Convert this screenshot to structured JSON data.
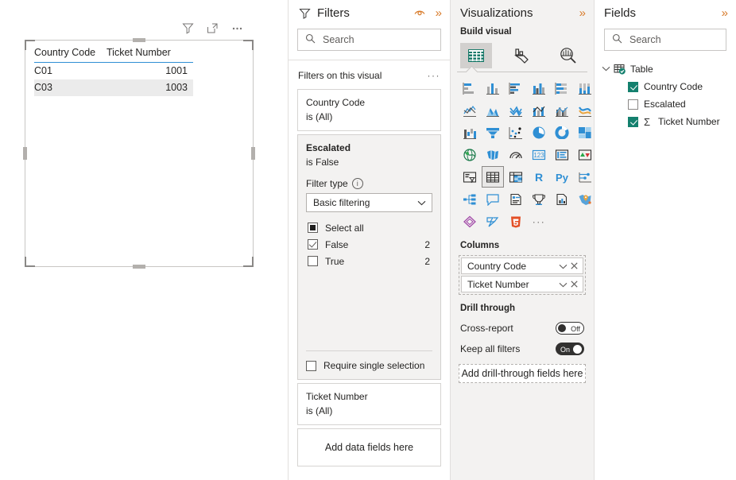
{
  "canvas": {
    "header_icons": [
      {
        "name": "filter-icon",
        "label": "Filters"
      },
      {
        "name": "focus-mode-icon",
        "label": "Focus mode"
      },
      {
        "name": "more-options-icon",
        "label": "More options"
      }
    ],
    "table_visual": {
      "columns": [
        "Country Code",
        "Ticket Number"
      ],
      "rows": [
        {
          "country_code": "C01",
          "ticket_number": "1001"
        },
        {
          "country_code": "C03",
          "ticket_number": "1003"
        }
      ],
      "header_underline_color": "#2f8fd4",
      "selected": true
    }
  },
  "filters": {
    "title": "Filters",
    "icons": {
      "eye": "hide-pane-icon",
      "expand": "expand-pane-icon"
    },
    "search": {
      "placeholder": "Search",
      "value": ""
    },
    "section_label": "Filters on this visual",
    "section_more": "···",
    "cards": [
      {
        "field": "Country Code",
        "condition": "is (All)",
        "active": false
      },
      {
        "field": "Escalated",
        "condition": "is False",
        "active": true
      }
    ],
    "filter_type_label": "Filter type",
    "filter_type_value": "Basic filtering",
    "checkboxes": [
      {
        "label": "Select all",
        "state": "indeterminate",
        "count": ""
      },
      {
        "label": "False",
        "state": "checked",
        "count": "2"
      },
      {
        "label": "True",
        "state": "unchecked",
        "count": "2"
      }
    ],
    "require_single_selection": {
      "label": "Require single selection",
      "state": "unchecked"
    },
    "trailing_card": {
      "field": "Ticket Number",
      "condition": "is (All)"
    },
    "add_data_fields": "Add data fields here"
  },
  "visualizations": {
    "title": "Visualizations",
    "expand_icon": "expand-pane-icon",
    "build_visual_label": "Build visual",
    "tabs": [
      {
        "name": "build-visual-tab",
        "icon": "fields-table-icon",
        "selected": true
      },
      {
        "name": "format-visual-tab",
        "icon": "paintbrush-icon",
        "selected": false
      },
      {
        "name": "analytics-tab",
        "icon": "magnifier-chart-icon",
        "selected": false
      }
    ],
    "gallery": [
      {
        "icon": "stacked-bar-chart-icon",
        "selected": false
      },
      {
        "icon": "stacked-column-chart-icon",
        "selected": false
      },
      {
        "icon": "clustered-bar-chart-icon",
        "selected": false
      },
      {
        "icon": "clustered-column-chart-icon",
        "selected": false
      },
      {
        "icon": "100-stacked-bar-chart-icon",
        "selected": false
      },
      {
        "icon": "100-stacked-column-chart-icon",
        "selected": false
      },
      {
        "icon": "line-chart-icon",
        "selected": false
      },
      {
        "icon": "area-chart-icon",
        "selected": false
      },
      {
        "icon": "stacked-area-chart-icon",
        "selected": false
      },
      {
        "icon": "line-and-stacked-column-chart-icon",
        "selected": false
      },
      {
        "icon": "line-and-clustered-column-chart-icon",
        "selected": false
      },
      {
        "icon": "ribbon-chart-icon",
        "selected": false
      },
      {
        "icon": "waterfall-chart-icon",
        "selected": false
      },
      {
        "icon": "funnel-chart-icon",
        "selected": false
      },
      {
        "icon": "scatter-chart-icon",
        "selected": false
      },
      {
        "icon": "pie-chart-icon",
        "selected": false
      },
      {
        "icon": "donut-chart-icon",
        "selected": false
      },
      {
        "icon": "treemap-icon",
        "selected": false
      },
      {
        "icon": "map-icon",
        "selected": false
      },
      {
        "icon": "filled-map-icon",
        "selected": false
      },
      {
        "icon": "gauge-icon",
        "selected": false
      },
      {
        "icon": "card-icon",
        "selected": false
      },
      {
        "icon": "multi-row-card-icon",
        "selected": false
      },
      {
        "icon": "kpi-icon",
        "selected": false
      },
      {
        "icon": "slicer-icon",
        "selected": false
      },
      {
        "icon": "table-icon",
        "selected": true
      },
      {
        "icon": "matrix-icon",
        "selected": false
      },
      {
        "icon": "r-script-visual-icon",
        "selected": false
      },
      {
        "icon": "python-visual-icon",
        "selected": false
      },
      {
        "icon": "key-influencers-icon",
        "selected": false
      },
      {
        "icon": "decomposition-tree-icon",
        "selected": false
      },
      {
        "icon": "qna-icon",
        "selected": false
      },
      {
        "icon": "smart-narrative-icon",
        "selected": false
      },
      {
        "icon": "metrics-icon",
        "selected": false
      },
      {
        "icon": "paginated-report-icon",
        "selected": false
      },
      {
        "icon": "azure-map-icon",
        "selected": false
      },
      {
        "icon": "power-apps-icon",
        "selected": false
      },
      {
        "icon": "power-automate-icon",
        "selected": false
      },
      {
        "icon": "html-visual-icon",
        "selected": false
      },
      {
        "icon": "get-more-visuals-icon",
        "label": "···",
        "selected": false
      }
    ],
    "columns_label": "Columns",
    "column_wells": [
      {
        "name": "Country Code"
      },
      {
        "name": "Ticket Number"
      }
    ],
    "drill_through_label": "Drill through",
    "cross_report": {
      "label": "Cross-report",
      "state": "Off",
      "on": false
    },
    "keep_all_filters": {
      "label": "Keep all filters",
      "state": "On",
      "on": true
    },
    "drill_drop_label": "Add drill-through fields here"
  },
  "fields": {
    "title": "Fields",
    "expand_icon": "expand-pane-icon",
    "search": {
      "placeholder": "Search",
      "value": ""
    },
    "table_node": {
      "label": "Table",
      "expanded": true
    },
    "items": [
      {
        "label": "Country Code",
        "checked": true,
        "aggregate": false
      },
      {
        "label": "Escalated",
        "checked": false,
        "aggregate": false
      },
      {
        "label": "Ticket Number",
        "checked": true,
        "aggregate": true
      }
    ]
  },
  "colors": {
    "accent_teal": "#14806e",
    "accent_blue": "#2f8fd4",
    "accent_orange": "#d87b2a",
    "pane_bg": "#f3f2f1"
  }
}
